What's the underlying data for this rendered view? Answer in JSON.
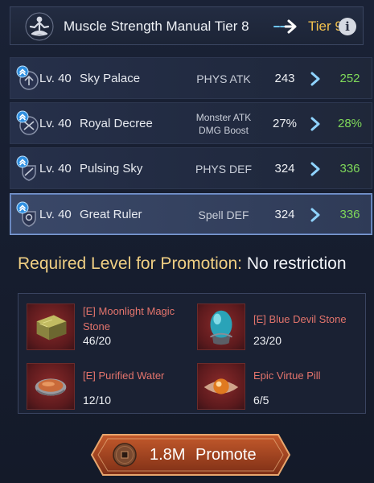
{
  "header": {
    "title": "Muscle Strength Manual Tier 8",
    "next_tier": "Tier 9",
    "info_glyph": "i",
    "manual_icon": "meditation-figure-icon",
    "arrow_icon": "arrow-right-icon"
  },
  "skills": [
    {
      "level": "Lv. 40",
      "name": "Sky Palace",
      "stat": "PHYS ATK",
      "current": "243",
      "next": "252"
    },
    {
      "level": "Lv. 40",
      "name": "Royal Decree",
      "stat": "Monster ATK DMG Boost",
      "stat_line1": "Monster ATK",
      "stat_line2": "DMG Boost",
      "current": "27%",
      "next": "28%"
    },
    {
      "level": "Lv. 40",
      "name": "Pulsing Sky",
      "stat": "PHYS DEF",
      "current": "324",
      "next": "336"
    },
    {
      "level": "Lv. 40",
      "name": "Great Ruler",
      "stat": "Spell DEF",
      "current": "324",
      "next": "336"
    }
  ],
  "requirement": {
    "label": "Required Level for Promotion:",
    "value": "No restriction"
  },
  "materials": [
    {
      "name": "[E] Moonlight Magic Stone",
      "count": "46/20",
      "icon": "moonlight-magic-stone-icon"
    },
    {
      "name": "[E] Blue Devil Stone",
      "count": "23/20",
      "icon": "blue-devil-stone-icon"
    },
    {
      "name": "[E] Purified Water",
      "count": "12/10",
      "icon": "purified-water-icon"
    },
    {
      "name": "Epic Virtue Pill",
      "count": "6/5",
      "icon": "epic-virtue-pill-icon"
    }
  ],
  "promote": {
    "cost": "1.8M",
    "label": "Promote",
    "coin_icon": "coin-icon"
  },
  "colors": {
    "gold": "#f2c14e",
    "upgrade_green": "#7fd95a",
    "material_name": "#e3746c",
    "selected_border": "#7d9bd1"
  }
}
